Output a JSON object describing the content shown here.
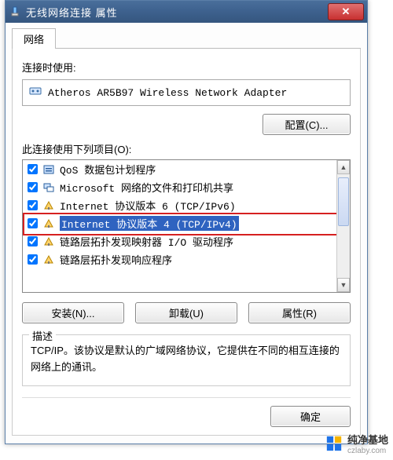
{
  "window": {
    "title": "无线网络连接 属性",
    "close_glyph": "✕"
  },
  "tab": {
    "label": "网络"
  },
  "connect_using_label": "连接时使用:",
  "adapter": {
    "name": "Atheros AR5B97 Wireless Network Adapter"
  },
  "configure_btn": "配置(C)...",
  "items_label": "此连接使用下列项目(O):",
  "items": [
    {
      "checked": true,
      "icon": "qos",
      "label": "QoS 数据包计划程序"
    },
    {
      "checked": true,
      "icon": "share",
      "label": "Microsoft 网络的文件和打印机共享"
    },
    {
      "checked": true,
      "icon": "proto",
      "label": "Internet 协议版本 6 (TCP/IPv6)"
    },
    {
      "checked": true,
      "icon": "proto",
      "label": "Internet 协议版本 4 (TCP/IPv4)",
      "selected": true
    },
    {
      "checked": true,
      "icon": "proto",
      "label": "链路层拓扑发现映射器 I/O 驱动程序"
    },
    {
      "checked": true,
      "icon": "proto",
      "label": "链路层拓扑发现响应程序"
    }
  ],
  "buttons": {
    "install": "安装(N)...",
    "uninstall": "卸载(U)",
    "properties": "属性(R)"
  },
  "description": {
    "legend": "描述",
    "text": "TCP/IP。该协议是默认的广域网络协议，它提供在不同的相互连接的网络上的通讯。"
  },
  "footer": {
    "ok": "确定"
  },
  "watermark": {
    "text": "纯净基地",
    "sub": "czlaby.com"
  }
}
